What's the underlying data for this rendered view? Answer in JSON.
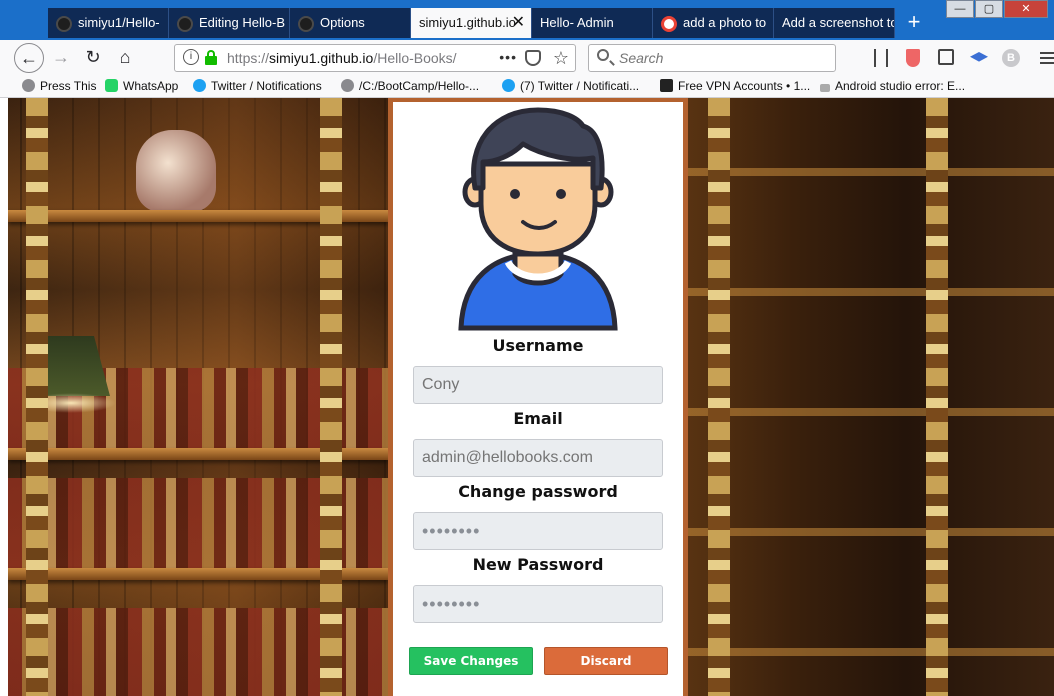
{
  "browser": {
    "tabs": [
      {
        "title": "simiyu1/Hello-",
        "icon": "github-icon",
        "active": false
      },
      {
        "title": "Editing Hello-B",
        "icon": "github-icon",
        "active": false
      },
      {
        "title": "Options",
        "icon": "github-icon",
        "active": false
      },
      {
        "title": "simiyu1.github.io",
        "icon": "none",
        "active": true
      },
      {
        "title": "Hello- Admin",
        "icon": "none",
        "active": false
      },
      {
        "title": "add a photo to",
        "icon": "google-icon",
        "active": false
      },
      {
        "title": "Add a screenshot to",
        "icon": "none",
        "active": false
      }
    ],
    "new_tab": "+",
    "window_buttons": {
      "minimize": "—",
      "maximize": "▢",
      "close": "✕"
    },
    "url": {
      "scheme": "https://",
      "host": "simiyu1.github.io",
      "path": "/Hello-Books/"
    },
    "more": "•••",
    "search_placeholder": "Search",
    "bookmarks": [
      {
        "label": "Press This",
        "icon": "globe-icon"
      },
      {
        "label": "WhatsApp",
        "icon": "whatsapp-icon"
      },
      {
        "label": "Twitter / Notifications",
        "icon": "twitter-icon"
      },
      {
        "label": "/C:/BootCamp/Hello-...",
        "icon": "globe-icon"
      },
      {
        "label": "(7) Twitter / Notificati...",
        "icon": "twitter-icon"
      },
      {
        "label": "Free VPN Accounts • 1...",
        "icon": "spark-icon"
      },
      {
        "label": "Android studio error: E...",
        "icon": "dots-icon"
      }
    ]
  },
  "profile": {
    "username_label": "Username",
    "username_placeholder": "Cony",
    "email_label": "Email",
    "email_placeholder": "admin@hellobooks.com",
    "change_password_label": "Change password",
    "change_password_value": "••••••••",
    "new_password_label": "New Password",
    "new_password_value": "••••••••",
    "save_label": "Save Changes",
    "discard_label": "Discard"
  },
  "colors": {
    "save": "#25c160",
    "discard": "#db6b3a",
    "card_border": "#b4622f",
    "tab_strip": "#1b6fc9"
  }
}
